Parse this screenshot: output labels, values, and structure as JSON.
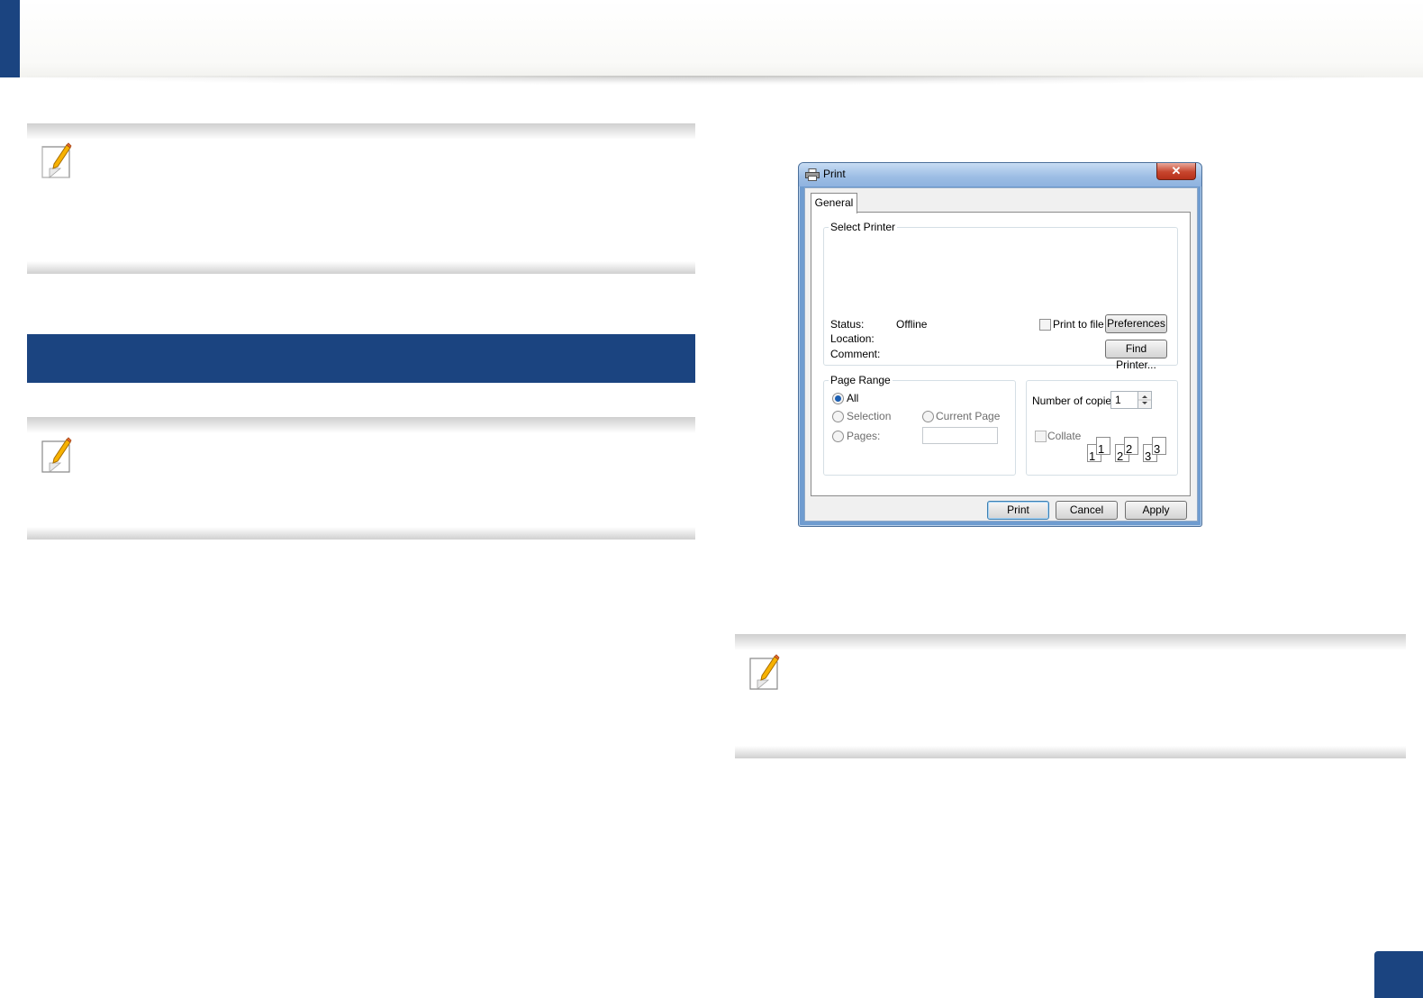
{
  "colors": {
    "brand_blue": "#1b4480",
    "dialog_frame": "#6f9cd0"
  },
  "icons": {
    "note": "note-pencil-icon",
    "printer": "printer-icon",
    "close": "close-icon"
  },
  "print_dialog": {
    "title": "Print",
    "close_glyph": "✕",
    "tab": "General",
    "select_printer": {
      "group_label": "Select Printer",
      "status_label": "Status:",
      "status_value": "Offline",
      "location_label": "Location:",
      "comment_label": "Comment:",
      "print_to_file": "Print to file",
      "preferences_button": "Preferences",
      "find_printer_button": "Find Printer..."
    },
    "page_range": {
      "group_label": "Page Range",
      "all": "All",
      "selection": "Selection",
      "current_page": "Current Page",
      "pages": "Pages:"
    },
    "copies": {
      "label": "Number of copies:",
      "value": "1",
      "collate": "Collate",
      "collate_pages": [
        "1",
        "1",
        "2",
        "2",
        "3",
        "3"
      ]
    },
    "buttons": {
      "print": "Print",
      "cancel": "Cancel",
      "apply": "Apply"
    }
  }
}
